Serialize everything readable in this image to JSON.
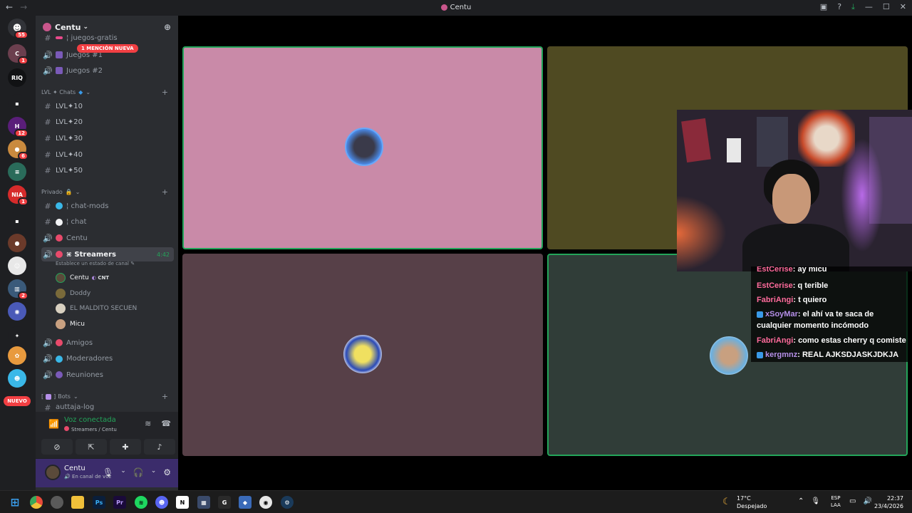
{
  "window": {
    "title": "Centu",
    "back_icon": "←",
    "forward_icon": "→"
  },
  "server_rail": {
    "dm_badge": "55",
    "servers": [
      {
        "label": "C",
        "badge": "1",
        "color": "#6b3f4e"
      },
      {
        "label": "RIQ",
        "badge": "",
        "color": "#111214"
      },
      {
        "label": "▪",
        "badge": "",
        "color": "#1e1f22"
      },
      {
        "label": "H",
        "badge": "12",
        "color": "#5a1e7a"
      },
      {
        "label": "●",
        "badge": "6",
        "color": "#c98a3e"
      },
      {
        "label": "≡",
        "badge": "",
        "color": "#2a6b5a"
      },
      {
        "label": "NIA",
        "badge": "1",
        "color": "#d62b2b"
      },
      {
        "label": "▪",
        "badge": "",
        "color": "#1e1f22"
      },
      {
        "label": "●",
        "badge": "",
        "color": "#6b3a2a"
      },
      {
        "label": "☺",
        "badge": "",
        "color": "#e8e8e8"
      },
      {
        "label": "▥",
        "badge": "2",
        "color": "#3a5a7a"
      },
      {
        "label": "◉",
        "badge": "",
        "color": "#4a5ab8"
      },
      {
        "label": "✦",
        "badge": "",
        "color": "#1e1f22"
      },
      {
        "label": "✿",
        "badge": "",
        "color": "#e89a3e"
      },
      {
        "label": "☻",
        "badge": "",
        "color": "#3ab8e8"
      }
    ],
    "new_label": "NUEVO"
  },
  "sidebar": {
    "server_name": "Centu",
    "mention_pill": "1 MENCIÓN NUEVA",
    "cut_channel": "¦ juegos-gratis",
    "voice_top": [
      {
        "name": "Juegos #1"
      },
      {
        "name": "Juegos #2"
      }
    ],
    "cat_lvl": "LVL ✦ Chats",
    "lvl_channels": [
      "LVL✦10",
      "LVL✦20",
      "LVL✦30",
      "LVL✦40",
      "LVL✦50"
    ],
    "cat_private": "Privado",
    "private_channels": [
      {
        "name": "¦ chat-mods",
        "icon": "#",
        "emo_color": "#3ab8e8"
      },
      {
        "name": "¦ chat",
        "icon": "#",
        "emo_color": "#f2f3f5"
      },
      {
        "name": "Centu",
        "icon": "🔊",
        "emo_color": "#e84a6b"
      }
    ],
    "streamers": {
      "name": "Streamers",
      "time": "4:42",
      "status": "Establece un estado de canal"
    },
    "voice_users": [
      {
        "name": "Centu",
        "tag": "CNT",
        "bright": true
      },
      {
        "name": "Doddy",
        "tag": "",
        "bright": false
      },
      {
        "name": "EL MALDITO SECUEN",
        "tag": "",
        "bright": false
      },
      {
        "name": "Micu",
        "tag": "",
        "bright": true
      }
    ],
    "more_channels": [
      "Amigos",
      "Moderadores",
      "Reuniones"
    ],
    "cat_bots": "Bots",
    "cut_bottom": "auttaja-log"
  },
  "voice_panel": {
    "title": "Voz conectada",
    "sub": "Streamers / Centu"
  },
  "user_panel": {
    "name": "Centu",
    "status": "En canal de voz"
  },
  "stage": {
    "tiles": [
      {
        "name": "tile-centu",
        "color": "#c98aa8",
        "speaking": true
      },
      {
        "name": "tile-olive",
        "color": "#4f4a22",
        "speaking": false
      },
      {
        "name": "tile-doddy",
        "color": "#574048",
        "speaking": false
      },
      {
        "name": "tile-micu",
        "color": "#303d38",
        "speaking": true
      }
    ]
  },
  "chat_overlay": [
    {
      "user": "EstCerise",
      "msg": ": ay micu",
      "lil": false
    },
    {
      "user": "EstCerise",
      "msg": ": q terible",
      "lil": false
    },
    {
      "user": "FabriAngi",
      "msg": ": t quiero",
      "lil": false
    },
    {
      "user": "xSoyMar",
      "msg": ": el ahí va te saca de cualquier momento incómodo",
      "lil": true
    },
    {
      "user": "FabriAngi",
      "msg": ": como estas cherry q comiste",
      "lil": false
    },
    {
      "user": "kergmnz",
      "msg": ": REAL AJKSDJASKJDKJA",
      "lil": true
    }
  ],
  "taskbar": {
    "temp": "17°C",
    "weather": "Despejado",
    "lang1": "ESP",
    "lang2": "LAA",
    "time": "22:37",
    "date": "23/4/2026"
  }
}
